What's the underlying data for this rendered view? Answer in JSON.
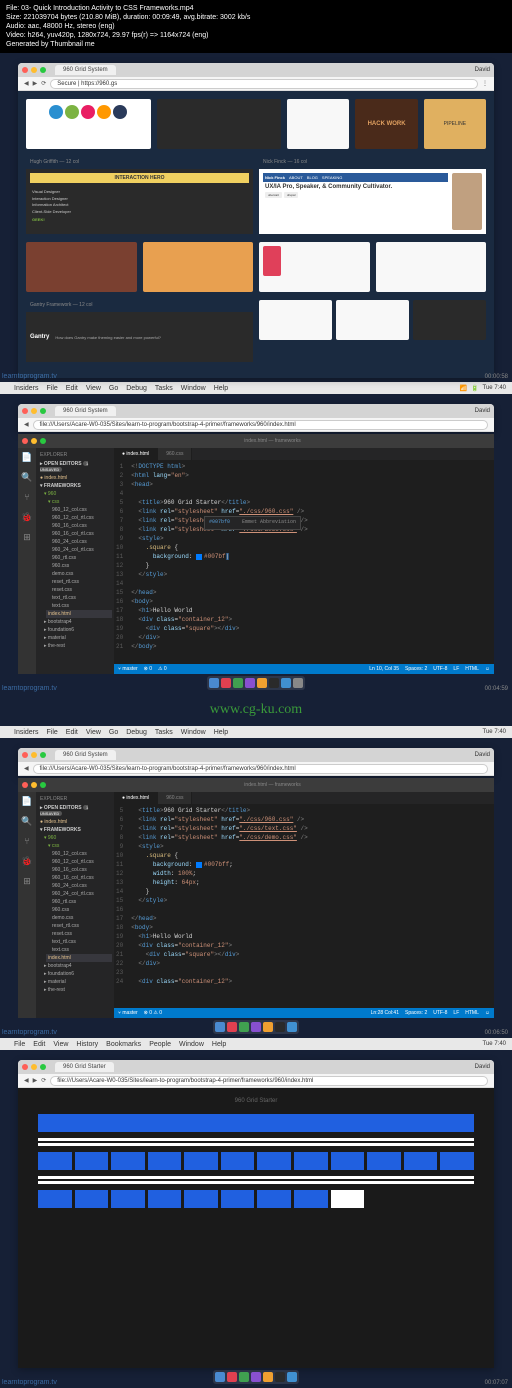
{
  "header": {
    "file": "File: 03- Quick Introduction Activity to  CSS Frameworks.mp4",
    "size": "Size: 221039704 bytes (210.80 MiB), duration: 00:09:49, avg.bitrate: 3002 kb/s",
    "audio": "Audio: aac, 48000 Hz, stereo (eng)",
    "video": "Video: h264, yuv420p, 1280x724, 29.97 fps(r) => 1164x724 (eng)",
    "generated": "Generated by Thumbnail me"
  },
  "menubar": {
    "items1": [
      "Insiders",
      "File",
      "Edit",
      "View",
      "Go",
      "Debug",
      "Tasks",
      "Window",
      "Help"
    ],
    "items_chrome": [
      "File",
      "Edit",
      "View",
      "History",
      "Bookmarks",
      "People",
      "Window",
      "Help"
    ],
    "clock": "Tue 7:40"
  },
  "browser": {
    "tab_title": "960 Grid System",
    "url_960": "Secure | https://960.gs",
    "url_file1": "file:///Users/Acare-W0-035/Sites/learn-to-program/bootstrap-4-primer/frameworks/960/index.html",
    "url_file2": "file:///Users/Acare-W0-035/Sites/learn-to-program/bootstrap-4-primer/frameworks/960/index.html",
    "profile": "David"
  },
  "gallery": {
    "label1": "Hugh Griffith — 12 col",
    "label2": "Nick Finck — 16 col",
    "label3": "Gantry Framework — 12 col",
    "ia_banner": "INTERACTION HERO",
    "ia_roles": [
      "Visual Designer",
      "Interaction Designer",
      "Information Architect",
      "Client-Side Developer"
    ],
    "ia_cta": "GEEK!",
    "nick_nav": [
      "Nick Finck",
      "ABOUT",
      "BLOG",
      "SPEAKING"
    ],
    "nick_headline": "UX/IA Pro, Speaker, & Community Cultivator.",
    "nick_badges": [
      "ubercart",
      "drupal"
    ],
    "gantry_logo": "Gantry",
    "gantry_text": "How does Gantry make theming easier and more powerful?",
    "hackwork": "HACK WORK",
    "pipeline": "PIPELINE"
  },
  "vscode": {
    "title_path": "index.html — frameworks",
    "sidebar_header": "EXPLORER",
    "open_editors": "OPEN EDITORS",
    "open_editors_count": "1 UNSAVED",
    "frameworks": "FRAMEWORKS",
    "files": {
      "index_active": "index.html",
      "folder_960": "960",
      "folder_css": "css",
      "css_files": [
        "960_12_col.css",
        "960_12_col_rtl.css",
        "960_16_col.css",
        "960_16_col_rtl.css",
        "960_24_col.css",
        "960_24_col_rtl.css",
        "960_rtl.css",
        "960.css",
        "demo.css",
        "reset_rtl.css",
        "reset.css",
        "text_rtl.css",
        "text.css"
      ],
      "index_html": "index.html",
      "others": [
        "bootstrap4",
        "foundation6",
        "material",
        "the-rest"
      ]
    },
    "tabs": {
      "index": "index.html",
      "css": "960.css"
    },
    "code1": {
      "l1": "<!DOCTYPE html>",
      "l2_open": "<html lang=\"en\">",
      "l3": "<head>",
      "l5": "<title>960 Grid Starter</title>",
      "l6": "<link rel=\"stylesheet\" href=\"./css/960.css\" />",
      "l7": "<link rel=\"stylesheet\" href=\"./css/text.css\" />",
      "l8": "<link rel=\"stylesheet\" href=\"./css/demo.css\" />",
      "l9": "<style>",
      "l10": ".square {",
      "l11a": "background: ",
      "l11b": "#007bf",
      "l11c": "#007bf0",
      "l11d": "Emmet Abbreviation",
      "l12": "}",
      "l13": "</style>",
      "l15": "</head>",
      "l16": "<body>",
      "l17": "<h1>Hello World",
      "l18": "<div class=\"container_12\">",
      "l19": "<div class=\"square\"></div>",
      "l20": "</div>",
      "l21": "</body>"
    },
    "code2": {
      "l5": "<title>960 Grid Starter</title>",
      "l6": "<link rel=\"stylesheet\" href=\"./css/960.css\" />",
      "l7": "<link rel=\"stylesheet\" href=\"./css/text.css\" />",
      "l8": "<link rel=\"stylesheet\" href=\"./css/demo.css\" />",
      "l9": "<style>",
      "l10": ".square {",
      "l11": "background: #007bff;",
      "l12": "width: 100%;",
      "l13": "height: 64px;",
      "l14": "}",
      "l15": "</style>",
      "l17": "</head>",
      "l18": "<body>",
      "l19": "<h1>Hello World",
      "l20": "<div class=\"container_12\">",
      "l21": "<div class=\"square\"></div>",
      "l22": "</div>",
      "l24": "<div class=\"container_12\">"
    },
    "status1": {
      "branch": "master",
      "errors": "0",
      "warnings": "0",
      "position": "Ln 10, Col 35",
      "spaces": "Spaces: 2",
      "encoding": "UTF-8",
      "eol": "LF",
      "lang": "HTML",
      "feedback": "☺"
    },
    "status2": {
      "position": "Ln:28 Col:41",
      "spaces": "Spaces: 2",
      "encoding": "UTF-8",
      "eol": "LF",
      "lang": "HTML"
    }
  },
  "grid_demo": {
    "title": "960 Grid Starter"
  },
  "watermark": {
    "tv": "learntoprogram.tv",
    "center": "www.cg-ku.com"
  },
  "timestamps": [
    "00:00:58",
    "00:04:59",
    "00:06:50",
    "00:07:07"
  ]
}
